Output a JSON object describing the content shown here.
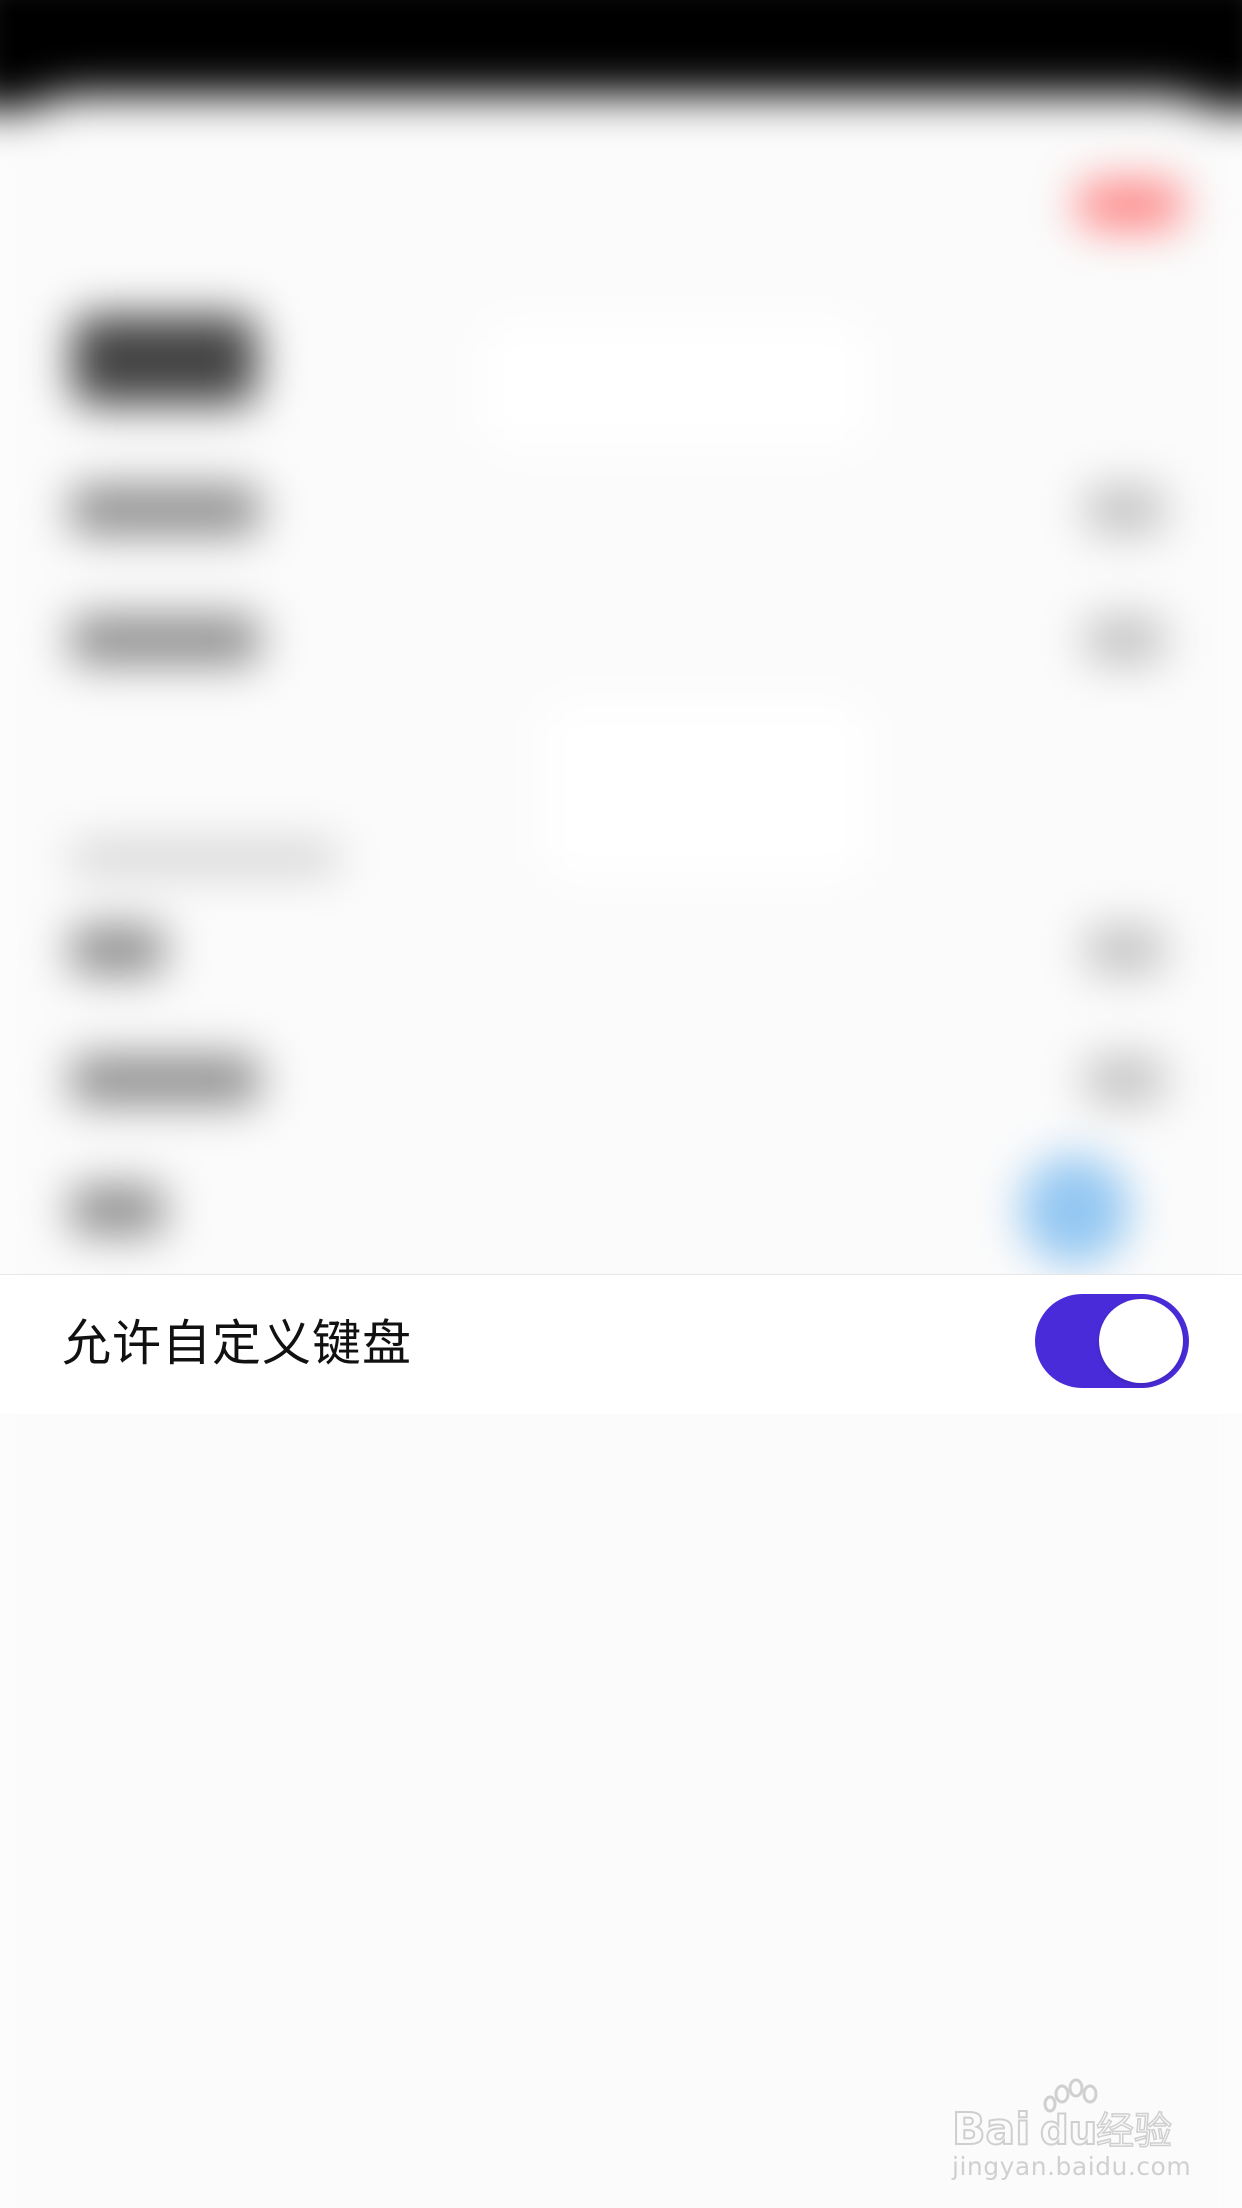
{
  "setting": {
    "label": "允许自定义键盘",
    "toggle_on": true,
    "toggle_color": "#4a2bd9"
  },
  "watermark": {
    "brand": "Baidu经验",
    "url": "jingyan.baidu.com"
  },
  "colors": {
    "status_bar": "#000000",
    "sheet": "#fbfbfb",
    "accent_red": "#ff6b6b",
    "accent_blue": "#79baf0"
  }
}
